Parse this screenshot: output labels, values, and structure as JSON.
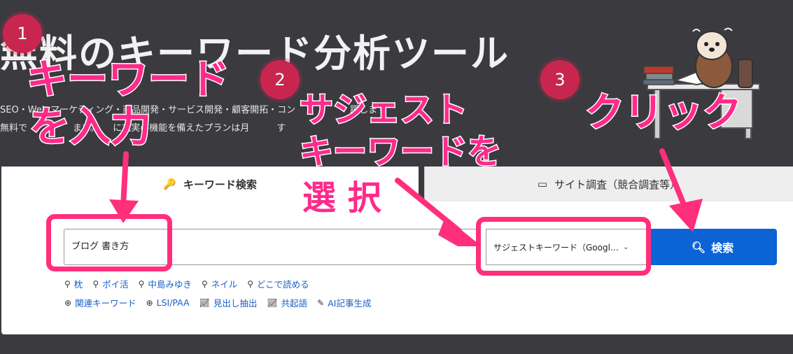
{
  "hero": {
    "title": "無料のキーワード分析ツール",
    "subtitle_line1": "SEO・Web マーケティング・商品開発・サービス開発・顧客開拓・コン　　　　　　躍します",
    "subtitle_line2": "無料で　　　　　ます。　　に充実の機能を備えたプランは月　　　す"
  },
  "tabs": {
    "keyword": "キーワード検索",
    "site": "サイト調査（競合調査等）"
  },
  "search": {
    "input_value": "ブログ 書き方",
    "select_value": "サジェストキーワード（Googl…",
    "button_label": "検索"
  },
  "suggest_chips": [
    "枕",
    "ポイ活",
    "中島みゆき",
    "ネイル",
    "どこで読める"
  ],
  "tool_links": [
    "関連キーワード",
    "LSI/PAA",
    "見出し抽出",
    "共起語",
    "AI記事生成"
  ],
  "annotations": {
    "step1_num": "1",
    "step1_text_line1": "キーワード",
    "step1_text_line2": "を入力",
    "step2_num": "2",
    "step2_text_line1": "サジェスト",
    "step2_text_line2": "キーワードを",
    "step2_text_line3": "選 択",
    "step3_num": "3",
    "step3_text": "クリック"
  },
  "colors": {
    "background": "#3a3a3f",
    "accent_pink": "#ff2f7c",
    "badge": "#c8264f",
    "button_blue": "#0b63d6"
  }
}
